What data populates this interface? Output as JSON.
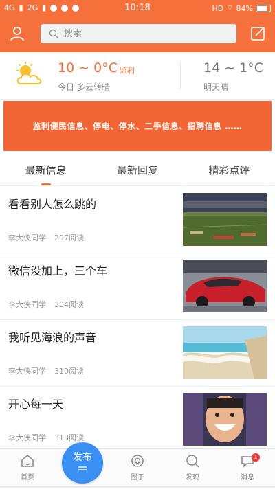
{
  "status_bar": {
    "network1": "4G",
    "network2": "2G",
    "time": "10:18",
    "right_label": "HD",
    "battery": "84%"
  },
  "header": {
    "search_placeholder": "搜索",
    "brand_color": "#f5703a"
  },
  "weather": {
    "today_temp": "10 ~ 0°C",
    "city": "监利",
    "today_desc": "今日 多云转晴",
    "tomorrow_temp": "14 ~ 1°C",
    "tomorrow_desc": "明天晴"
  },
  "banner": {
    "text": "监利便民信息、停电、停水、二手信息、招聘信息 ……"
  },
  "tabs": [
    {
      "label": "最新信息",
      "active": true
    },
    {
      "label": "最新回复",
      "active": false
    },
    {
      "label": "精彩点评",
      "active": false
    }
  ],
  "feed": [
    {
      "title": "看看别人怎么跳的",
      "author": "李大侠同学",
      "views": "297阅读",
      "thumb": "sports-field"
    },
    {
      "title": "微信没加上，三个车",
      "author": "李大侠同学",
      "views": "304阅读",
      "thumb": "red-car"
    },
    {
      "title": "我听见海浪的声音",
      "author": "李大侠同学",
      "views": "310阅读",
      "thumb": "beach-waves"
    },
    {
      "title": "开心每一天",
      "author": "李大侠同学",
      "views": "313阅读",
      "thumb": "smiling-man"
    }
  ],
  "bottom_nav": {
    "home": "首页",
    "publish": "发布",
    "circle": "圈子",
    "discover": "发现",
    "messages": "消息",
    "messages_badge": "1"
  }
}
